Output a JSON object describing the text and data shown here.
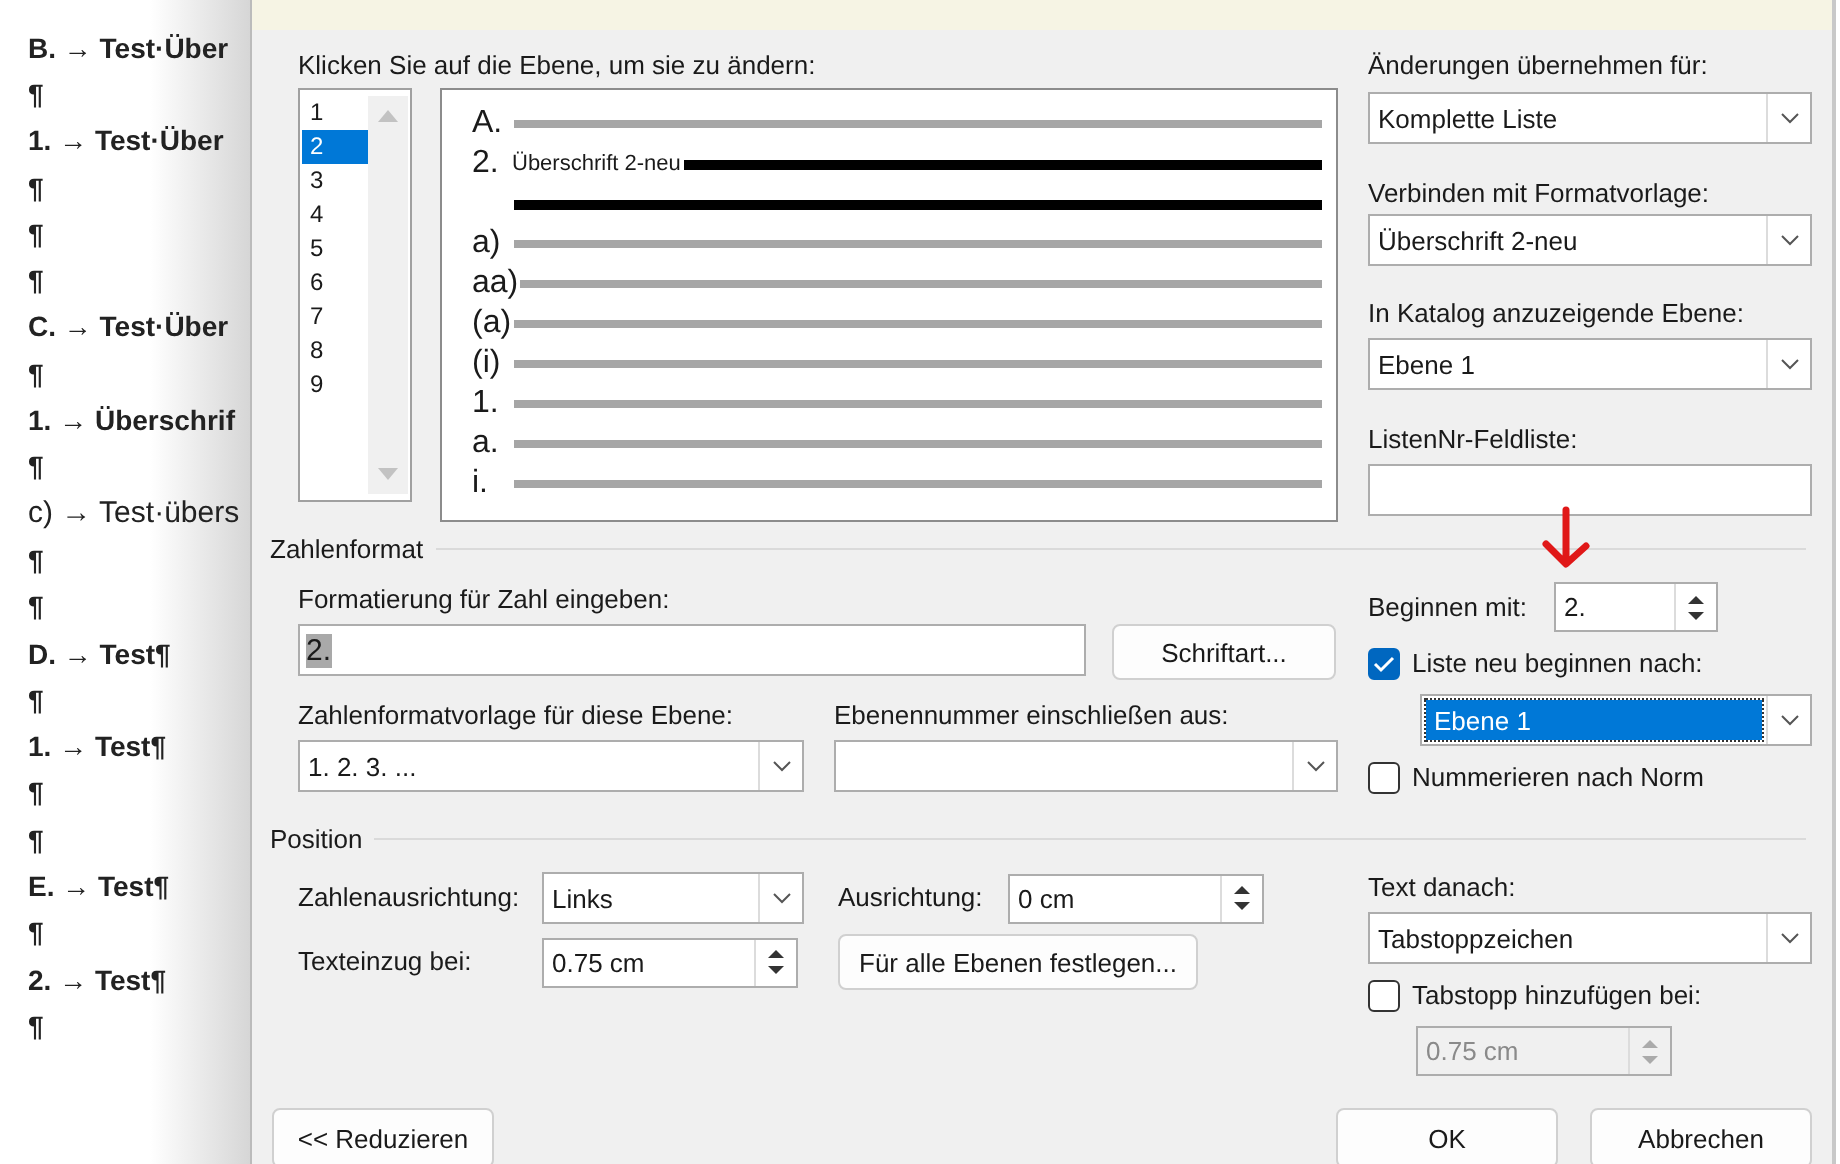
{
  "document": {
    "lines": [
      {
        "text": "B. → Test·Über",
        "bold": true
      },
      {
        "text": "¶",
        "bold": true
      },
      {
        "text": "1. → Test·Über",
        "bold": true
      },
      {
        "text": "¶",
        "bold": true
      },
      {
        "text": "¶",
        "bold": true
      },
      {
        "text": "¶",
        "bold": true
      },
      {
        "text": "C. → Test·Über",
        "bold": true
      },
      {
        "text": "¶",
        "bold": true
      },
      {
        "text": "1. → Überschrif",
        "bold": true
      },
      {
        "text": "¶",
        "bold": true
      },
      {
        "text": "c) → Test·übers",
        "bold": false
      },
      {
        "text": "¶",
        "bold": true
      },
      {
        "text": "¶",
        "bold": true
      },
      {
        "text": "D. → Test¶",
        "bold": true
      },
      {
        "text": "¶",
        "bold": true
      },
      {
        "text": "1. → Test¶",
        "bold": true
      },
      {
        "text": "¶",
        "bold": true
      },
      {
        "text": "¶",
        "bold": true
      },
      {
        "text": "E. → Test¶",
        "bold": true
      },
      {
        "text": "¶",
        "bold": true
      },
      {
        "text": "2. → Test¶",
        "bold": true
      },
      {
        "text": "¶",
        "bold": true
      }
    ]
  },
  "dialog": {
    "level_prompt": "Klicken Sie auf die Ebene, um sie zu ändern:",
    "levels": [
      {
        "label": "1",
        "selected": false
      },
      {
        "label": "2",
        "selected": true
      },
      {
        "label": "3",
        "selected": false
      },
      {
        "label": "4",
        "selected": false
      },
      {
        "label": "5",
        "selected": false
      },
      {
        "label": "6",
        "selected": false
      },
      {
        "label": "7",
        "selected": false
      },
      {
        "label": "8",
        "selected": false
      },
      {
        "label": "9",
        "selected": false
      }
    ],
    "preview": [
      {
        "label": "A.",
        "selected": false
      },
      {
        "label": "2.",
        "text": "Überschrift 2-neu",
        "selected": true
      },
      {
        "label": "a)",
        "selected": false
      },
      {
        "label": "aa)",
        "selected": false
      },
      {
        "label": "(a)",
        "selected": false
      },
      {
        "label": "(i)",
        "selected": false
      },
      {
        "label": "1.",
        "selected": false
      },
      {
        "label": "a.",
        "selected": false
      },
      {
        "label": "i.",
        "selected": false
      }
    ],
    "apply_to": {
      "label": "Änderungen übernehmen für:",
      "value": "Komplette Liste"
    },
    "link_style": {
      "label": "Verbinden mit Formatvorlage:",
      "value": "Überschrift 2-neu"
    },
    "gallery_level": {
      "label": "In Katalog anzuzeigende Ebene:",
      "value": "Ebene 1"
    },
    "listnum_field": {
      "label": "ListenNr-Feldliste:"
    },
    "number_format": {
      "title": "Zahlenformat",
      "format_label": "Formatierung für Zahl eingeben:",
      "format_value": "2.",
      "format_highlighted": true,
      "font_button": "Schriftart...",
      "style_label": "Zahlenformatvorlage für diese Ebene:",
      "style_value": "1. 2. 3. ...",
      "include_label": "Ebenennummer einschließen aus:"
    },
    "start_at": {
      "label": "Beginnen mit:",
      "value": "2."
    },
    "restart": {
      "label": "Liste neu beginnen nach:",
      "checked": true,
      "value": "Ebene 1",
      "highlighted": true
    },
    "legal": {
      "label": "Nummerieren nach Norm",
      "checked": false
    },
    "position": {
      "title": "Position",
      "alignment_label": "Zahlenausrichtung:",
      "alignment_value": "Links",
      "aligned_at_label": "Ausrichtung:",
      "aligned_at_value": "0 cm",
      "indent_label": "Texteinzug bei:",
      "indent_value": "0.75 cm",
      "set_all_button": "Für alle Ebenen festlegen..."
    },
    "follow": {
      "label": "Text danach:",
      "value": "Tabstoppzeichen"
    },
    "tab_stop": {
      "label": "Tabstopp hinzufügen bei:",
      "checked": false,
      "value": "0.75 cm",
      "disabled": true
    },
    "buttons": [
      {
        "label": "<< Reduzieren"
      },
      {
        "label": "OK"
      },
      {
        "label": "Abbrechen"
      }
    ]
  }
}
